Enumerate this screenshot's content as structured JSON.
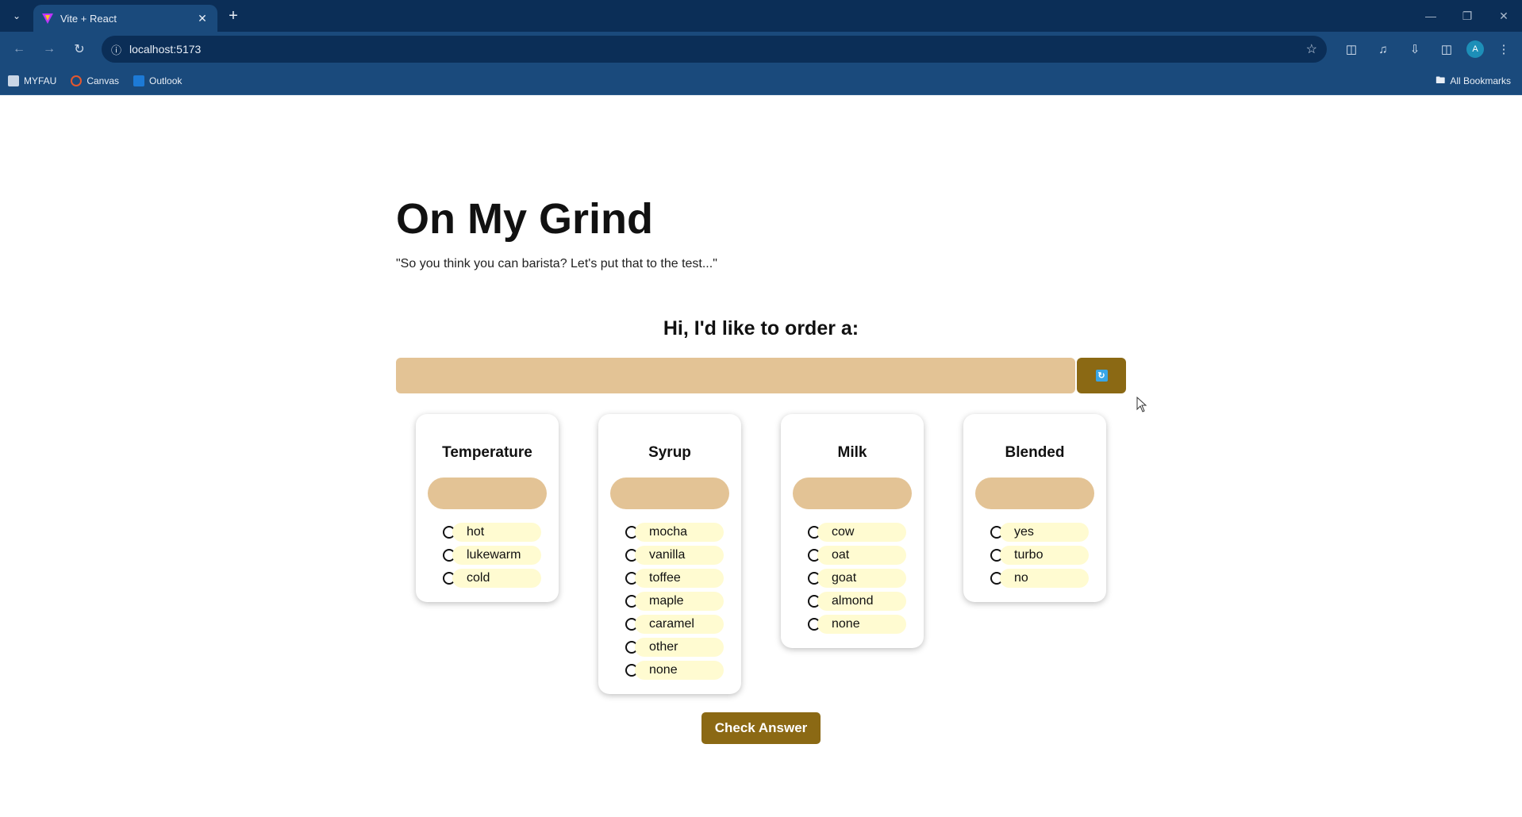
{
  "browser": {
    "tab_title": "Vite + React",
    "new_tab": "+",
    "url": "localhost:5173",
    "bookmarks": [
      {
        "label": "MYFAU"
      },
      {
        "label": "Canvas"
      },
      {
        "label": "Outlook"
      }
    ],
    "all_bookmarks": "All Bookmarks",
    "profile_initial": "A"
  },
  "app": {
    "title": "On My Grind",
    "tagline": "\"So you think you can barista? Let's put that to the test...\"",
    "prompt": "Hi, I'd like to order a:",
    "check_button": "Check Answer"
  },
  "categories": [
    {
      "name": "Temperature",
      "options": [
        "hot",
        "lukewarm",
        "cold"
      ]
    },
    {
      "name": "Syrup",
      "options": [
        "mocha",
        "vanilla",
        "toffee",
        "maple",
        "caramel",
        "other",
        "none"
      ]
    },
    {
      "name": "Milk",
      "options": [
        "cow",
        "oat",
        "goat",
        "almond",
        "none"
      ]
    },
    {
      "name": "Blended",
      "options": [
        "yes",
        "turbo",
        "no"
      ]
    }
  ],
  "colors": {
    "accent_button": "#8b6914",
    "tan": "#e3c395",
    "pill": "#fffbd1",
    "chrome": "#1a4a7c"
  }
}
